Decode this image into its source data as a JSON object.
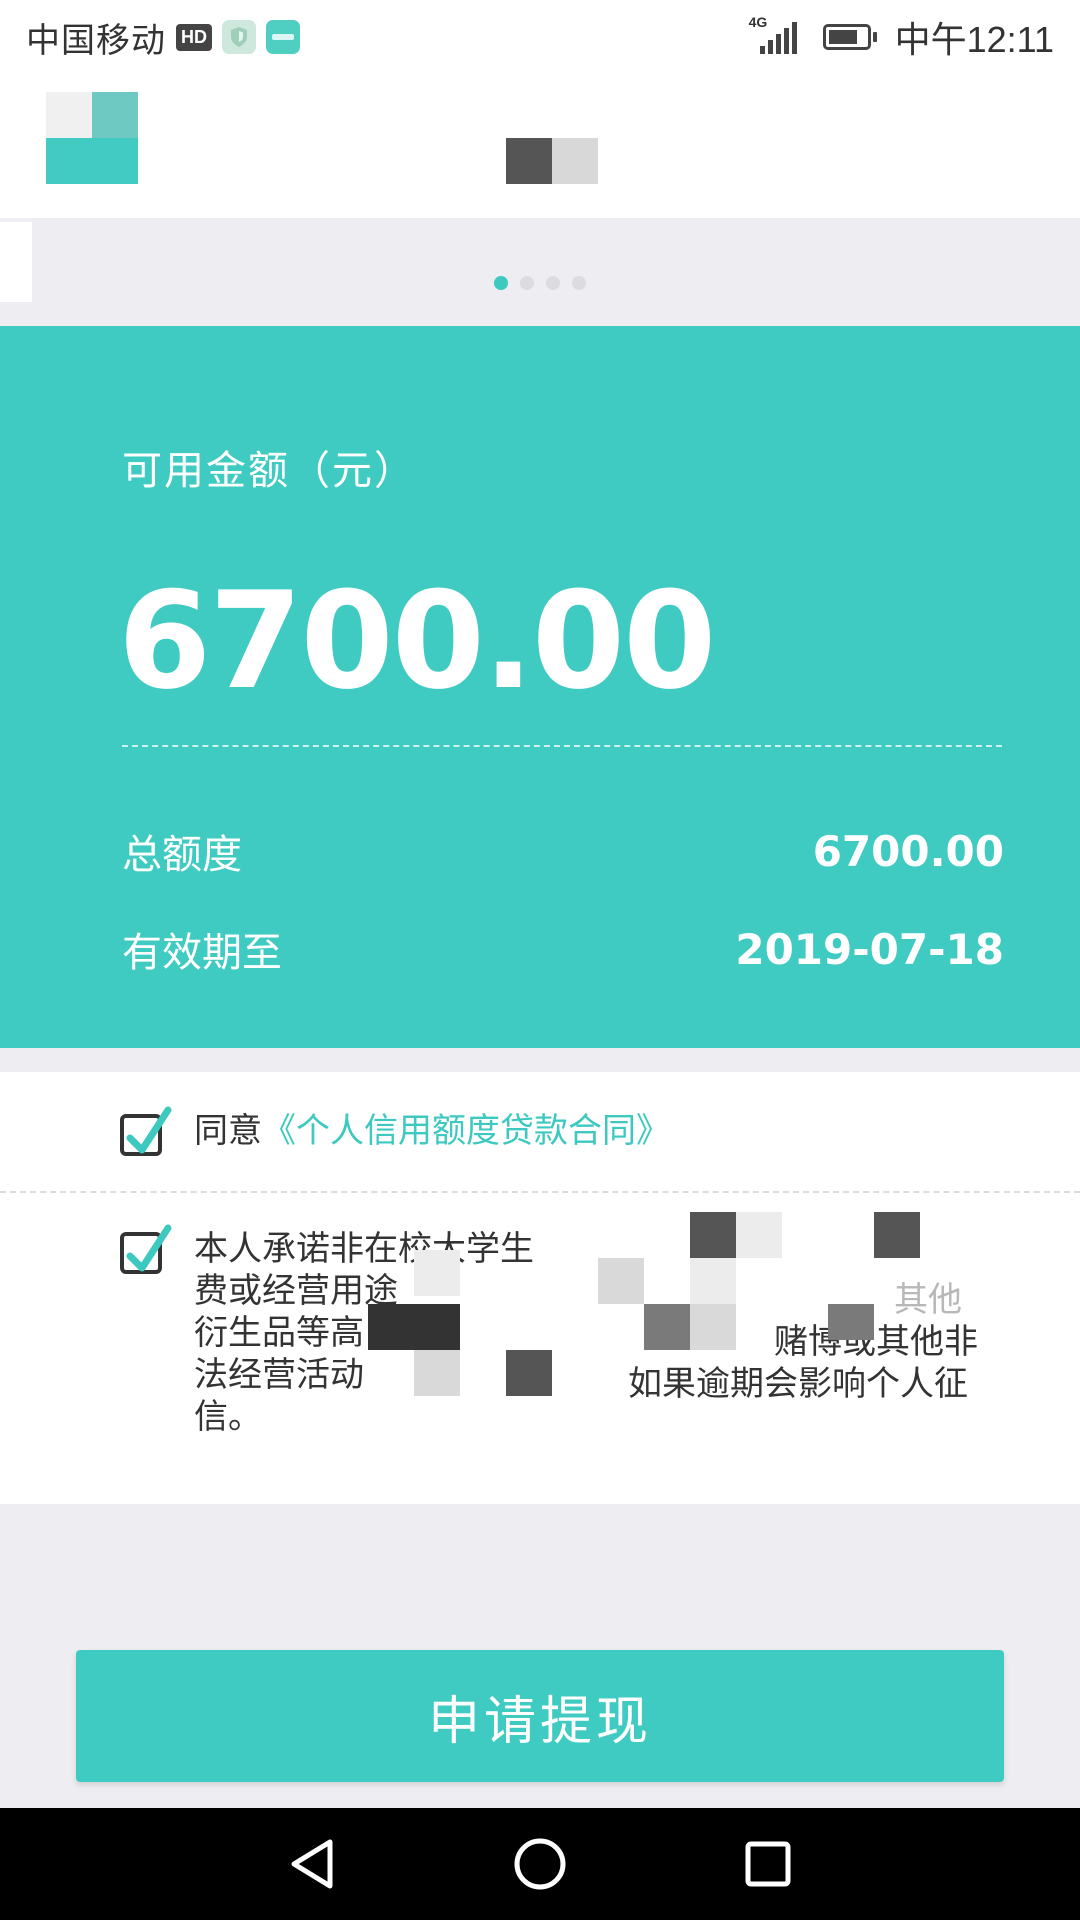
{
  "status_bar": {
    "carrier": "中国移动",
    "hd_badge": "HD",
    "network": "4G",
    "time": "中午12:11"
  },
  "card": {
    "available_label": "可用金额（元）",
    "available_amount": "6700.00",
    "total_label": "总额度",
    "total_value": "6700.00",
    "expiry_label": "有效期至",
    "expiry_value": "2019-07-18",
    "background_color": "#40cbc2"
  },
  "agreements": {
    "contract_prefix": "同意",
    "contract_link": "《个人信用额度贷款合同》",
    "promise_line1": "本人承诺非在校大学生",
    "promise_line2": "费或经营用途",
    "promise_line2_end": "其他",
    "promise_line3": "衍生品等高",
    "promise_line3_end": "赌博或其他非",
    "promise_line4": "法经营活动",
    "promise_line4_end": "如果逾期会影响个人征",
    "promise_line5": "信。"
  },
  "apply_button": {
    "label": "申请提现"
  },
  "banner": {
    "page_count": 4,
    "active_page": 1
  },
  "icons": {
    "status": [
      "shield-icon",
      "meituan-icon",
      "signal-icon",
      "battery-icon"
    ],
    "nav": [
      "back-icon",
      "home-icon",
      "recents-icon"
    ],
    "checkbox": "check-icon"
  },
  "accent_color": "#3ec9c0"
}
